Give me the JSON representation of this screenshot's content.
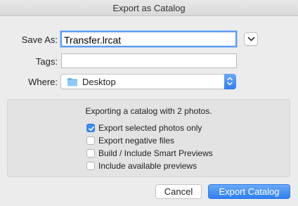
{
  "window": {
    "title": "Export as Catalog"
  },
  "save_as": {
    "label": "Save As:",
    "value": "Transfer.lrcat"
  },
  "tags": {
    "label": "Tags:",
    "value": ""
  },
  "where": {
    "label": "Where:",
    "value": "Desktop"
  },
  "options": {
    "heading": "Exporting a catalog with 2 photos.",
    "items": [
      {
        "label": "Export selected photos only",
        "checked": true
      },
      {
        "label": "Export negative files",
        "checked": false
      },
      {
        "label": "Build / Include Smart Previews",
        "checked": false
      },
      {
        "label": "Include available previews",
        "checked": false
      }
    ]
  },
  "buttons": {
    "cancel": "Cancel",
    "export": "Export Catalog"
  },
  "colors": {
    "accent": "#2f7ff0",
    "focus_ring": "#5b9bf0",
    "background": "#ececec"
  }
}
